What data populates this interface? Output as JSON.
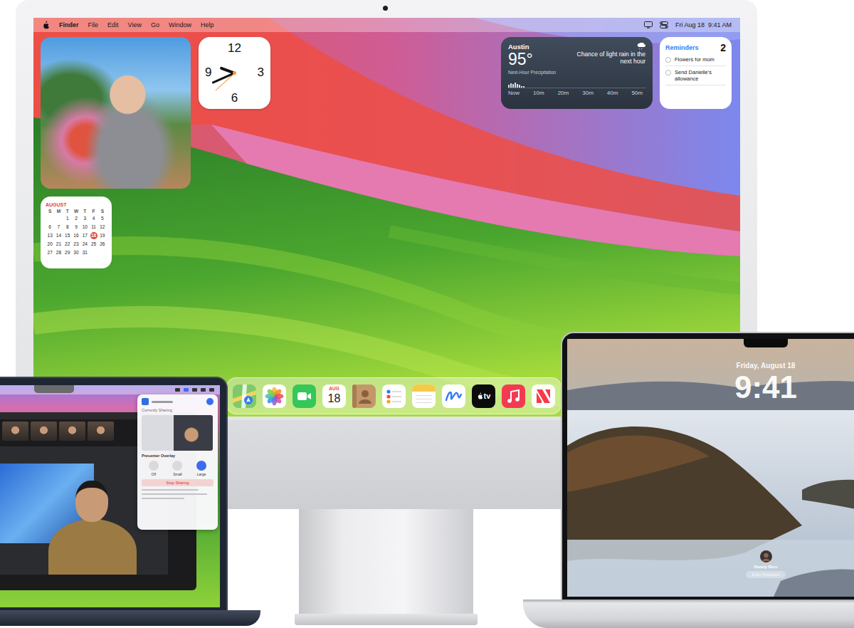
{
  "imac": {
    "menu_bar": {
      "app": "Finder",
      "menus": [
        "File",
        "Edit",
        "View",
        "Go",
        "Window",
        "Help"
      ],
      "clock": "Fri Aug 18  9:41 AM"
    },
    "clock_widget": {
      "numerals": [
        "12",
        "3",
        "6",
        "9"
      ],
      "hour": 9,
      "minute": 41,
      "second": 38
    },
    "calendar_widget": {
      "month": "AUGUST",
      "weekdays": [
        "S",
        "M",
        "T",
        "W",
        "T",
        "F",
        "S"
      ],
      "weeks": [
        [
          {
            "day": "1",
            "today": false
          },
          {
            "day": "2",
            "today": false
          },
          {
            "day": "3",
            "today": false
          },
          {
            "day": "4",
            "today": false
          },
          {
            "day": "5",
            "today": false
          }
        ],
        [
          {
            "day": "6",
            "today": false
          },
          {
            "day": "7",
            "today": false
          },
          {
            "day": "8",
            "today": false
          },
          {
            "day": "9",
            "today": false
          },
          {
            "day": "10",
            "today": false
          },
          {
            "day": "11",
            "today": false
          },
          {
            "day": "12",
            "today": false
          }
        ],
        [
          {
            "day": "13",
            "today": false
          },
          {
            "day": "14",
            "today": false
          },
          {
            "day": "15",
            "today": false
          },
          {
            "day": "16",
            "today": false
          },
          {
            "day": "17",
            "today": false
          },
          {
            "day": "18",
            "today": true
          },
          {
            "day": "19",
            "today": false
          }
        ],
        [
          {
            "day": "20",
            "today": false
          },
          {
            "day": "21",
            "today": false
          },
          {
            "day": "22",
            "today": false
          },
          {
            "day": "23",
            "today": false
          },
          {
            "day": "24",
            "today": false
          },
          {
            "day": "25",
            "today": false
          },
          {
            "day": "26",
            "today": false
          }
        ],
        [
          {
            "day": "27",
            "today": false
          },
          {
            "day": "28",
            "today": false
          },
          {
            "day": "29",
            "today": false
          },
          {
            "day": "30",
            "today": false
          },
          {
            "day": "31",
            "today": false
          }
        ]
      ]
    },
    "weather_widget": {
      "city": "Austin",
      "temperature": "95°",
      "forecast": "Chance of light rain in the next hour",
      "chart_label": "Next-Hour Precipitation",
      "ticks": [
        "Now",
        "10m",
        "20m",
        "30m",
        "40m",
        "50m"
      ],
      "precipitation": [
        0.35,
        0.5,
        0.45,
        0.6,
        0.4,
        0.3,
        0.2,
        0.15
      ]
    },
    "reminders_widget": {
      "title": "Reminders",
      "count": "2",
      "items": [
        {
          "text": "Flowers for mom",
          "checked": false
        },
        {
          "text": "Send Danielle's allowance",
          "checked": false
        }
      ]
    },
    "dock": {
      "apps": [
        {
          "kind": "maps"
        },
        {
          "kind": "photos"
        },
        {
          "kind": "facetime"
        },
        {
          "kind": "calendar",
          "month": "AUG",
          "day": "18"
        },
        {
          "kind": "contacts"
        },
        {
          "kind": "reminders"
        },
        {
          "kind": "notes"
        },
        {
          "kind": "freeform"
        },
        {
          "kind": "tv",
          "label": "tv"
        },
        {
          "kind": "music"
        },
        {
          "kind": "news"
        }
      ]
    }
  },
  "left_laptop": {
    "sharing_panel": {
      "heading": "Currently Sharing",
      "section": "Presenter Overlay",
      "options": [
        {
          "label": "Off",
          "selected": false
        },
        {
          "label": "Small",
          "selected": false
        },
        {
          "label": "Large",
          "selected": true
        }
      ],
      "button": "Stop Sharing"
    }
  },
  "right_laptop": {
    "lock_screen": {
      "date": "Friday, August 18",
      "time": "9:41",
      "user": "Danny Rico",
      "password_placeholder": "Enter Password"
    }
  }
}
